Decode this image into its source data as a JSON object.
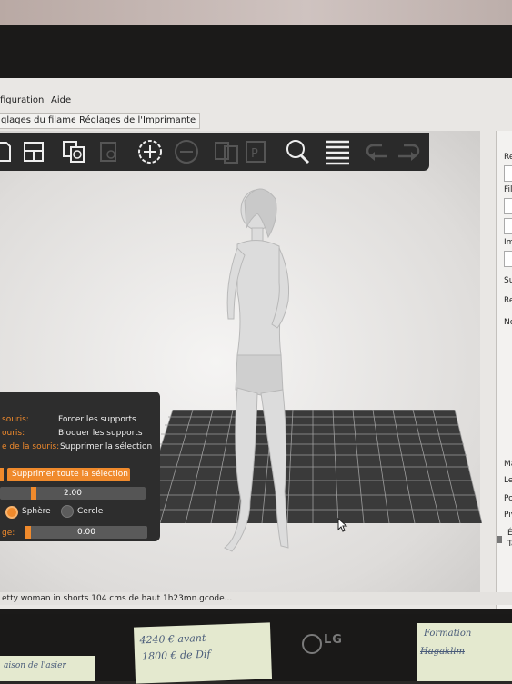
{
  "menu": {
    "config": "figuration",
    "help": "Aide"
  },
  "tabs": {
    "filament": "glages du filament",
    "printer": "Réglages de l'Imprimante"
  },
  "toolbar": {
    "icons": [
      "open-file-icon",
      "layout-icon",
      "copy-icon",
      "paste-icon",
      "add-icon",
      "remove-icon",
      "group-icon",
      "settings-icon",
      "zoom-icon",
      "layers-icon",
      "undo-icon",
      "redo-icon"
    ]
  },
  "support_panel": {
    "rows": [
      {
        "label": "souris:",
        "value": "Forcer les supports"
      },
      {
        "label": "ouris:",
        "value": "Bloquer les supports"
      },
      {
        "label": "e de la souris:",
        "value": "Supprimer la sélection"
      }
    ],
    "remove_all": "Supprimer toute la sélection",
    "size_value": "2.00",
    "shape_sphere": "Sphère",
    "shape_circle": "Cercle",
    "angle_label": "ge:",
    "angle_value": "0.00"
  },
  "right_panel": {
    "labels": [
      "Re",
      "Fil",
      "Im",
      "Suppo",
      "Ren",
      "No",
      "Ma",
      "Les",
      "Posit",
      "Pivo",
      "É",
      "Ta"
    ]
  },
  "status": {
    "file": "etty woman in shorts 104 cms de haut 1h23mn.gcode..."
  },
  "monitor": {
    "brand": "LG"
  },
  "sticky_notes": {
    "center_line1": "4240 €  avant",
    "center_line2": "1800 € de Dif",
    "left": "aison de l'asier",
    "right_line1": "Formation",
    "right_line2": "Hagaklim"
  },
  "colors": {
    "accent": "#f08a2c",
    "panel": "#2d2d2d",
    "toolbar": "#2a2a2a"
  }
}
